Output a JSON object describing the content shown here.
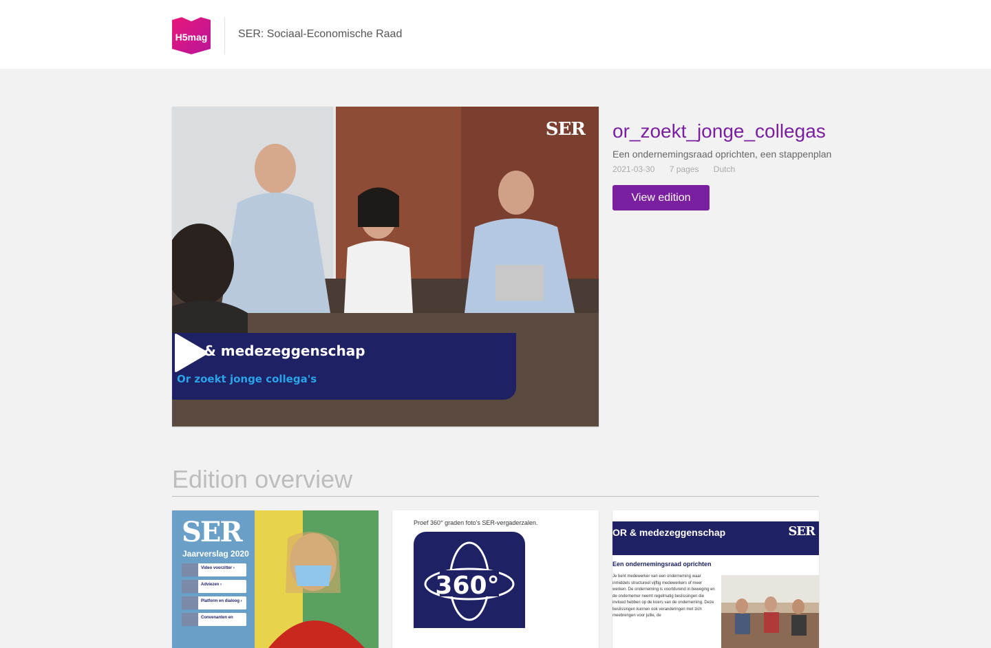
{
  "header": {
    "logo_text": "H5mag",
    "org_name": "SER: Sociaal-Economische Raad"
  },
  "hero": {
    "brand": "SER",
    "banner_title": "OR & medezeggenschap",
    "banner_subtitle": "Or zoekt jonge collega's",
    "play_icon": "play-icon"
  },
  "edition": {
    "title": "or_zoekt_jonge_collegas",
    "description": "Een ondernemingsraad oprichten, een stappenplan",
    "date": "2021-03-30",
    "pages": "7 pages",
    "language": "Dutch",
    "view_label": "View edition"
  },
  "overview": {
    "heading": "Edition overview",
    "cards": [
      {
        "brand": "SER",
        "subtitle": "Jaarverslag 2020",
        "buttons": [
          "Video voorzitter ›",
          "Adviezen ›",
          "Platform en dialoog ›",
          "Convenanten en"
        ]
      },
      {
        "caption": "Proef 360° graden foto's SER-vergaderzalen.",
        "badge": "360°"
      },
      {
        "title": "OR & medezeggenschap",
        "brand": "SER",
        "heading": "Een ondernemingsraad oprichten",
        "body": "Je bent medewerker van een onderneming waar inmiddels structureel vijftig medewerkers of meer werken. De onderneming is voortdurend in beweging en de ondernemer neemt regelmatig beslissingen die invloed hebben op de koers van de onderneming. Deze beslissingen kunnen ook veranderingen met zich meebrengen voor jullie, de"
      }
    ]
  },
  "colors": {
    "accent": "#7a1fa0",
    "navy": "#1e2164",
    "subtitle_blue": "#2aa3e8",
    "logo_pink": "#e8177a"
  }
}
